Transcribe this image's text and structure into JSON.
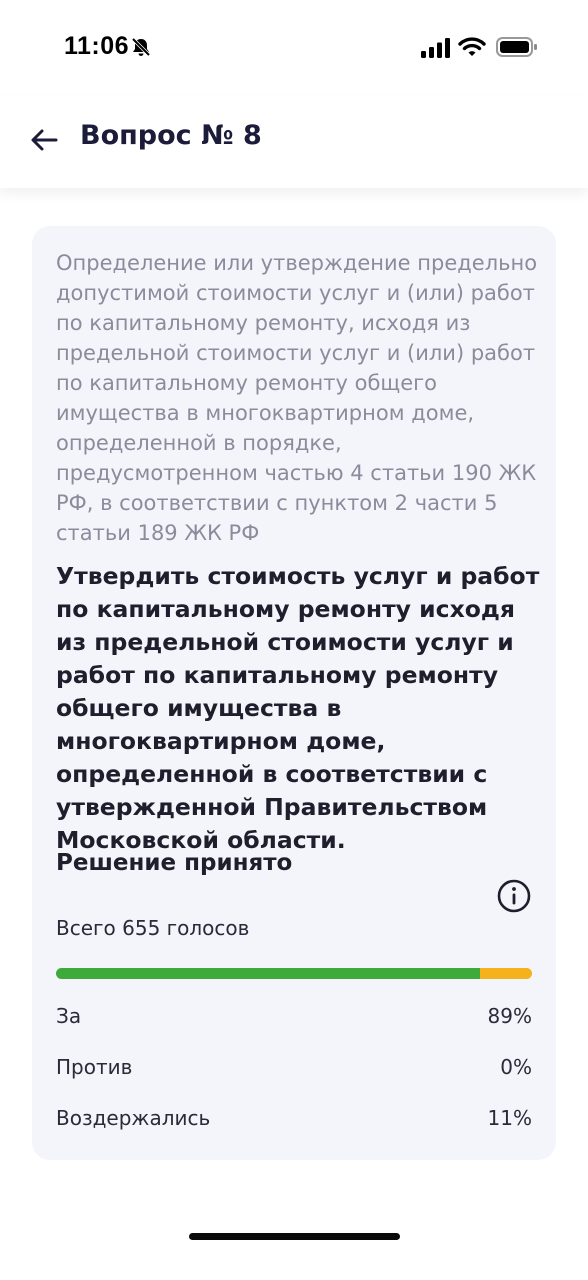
{
  "status_bar": {
    "time": "11:06",
    "icons": [
      "bell-slash-icon",
      "signal-icon",
      "wifi-icon",
      "battery-icon"
    ]
  },
  "header": {
    "back_icon": "arrow-left-icon",
    "title": "Вопрос № 8"
  },
  "question": {
    "text": "Определение или утверждение предельно допустимой стоимости услуг и (или) работ по капитальному ремонту, исходя из предельной стоимости услуг и (или) работ по капитальному ремонту общего имущества в многоквартирном доме, определенной в порядке, предусмотренном частью 4 статьи 190 ЖК РФ, в соответствии с пунктом 2 части 5 статьи 189 ЖК РФ",
    "decision": "Утвердить стоимость услуг и работ по капитальному ремонту исходя из предельной стоимости услуг и работ по капитальному ремонту общего имущества в многоквартирном доме, определенной в соответствии с утвержденной Правительством Московской области."
  },
  "results": {
    "status": "Решение принято",
    "info_icon": "info-circle-icon",
    "total": "Всего 655 голосов",
    "bar": [
      {
        "name": "За",
        "fraction": 0.89,
        "color": "#3faa3c"
      },
      {
        "name": "Против",
        "fraction": 0.0,
        "color": "#e04a3a"
      },
      {
        "name": "Воздержались",
        "fraction": 0.11,
        "color": "#f5b21c"
      }
    ],
    "rows": [
      {
        "label": "За",
        "value": "89%"
      },
      {
        "label": "Против",
        "value": "0%"
      },
      {
        "label": "Воздержались",
        "value": "11%"
      }
    ]
  }
}
